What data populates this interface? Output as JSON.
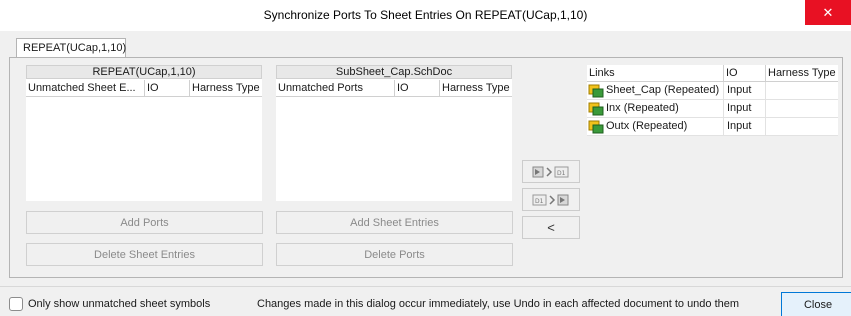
{
  "window": {
    "title": "Synchronize Ports To Sheet Entries On REPEAT(UCap,1,10)",
    "close_glyph": "✕"
  },
  "tab": {
    "label": "REPEAT(UCap,1,10)"
  },
  "left_grid": {
    "caption": "REPEAT(UCap,1,10)",
    "columns": [
      "Unmatched Sheet E...",
      "IO",
      "Harness Type"
    ],
    "buttons": {
      "add": "Add Ports",
      "delete": "Delete Sheet Entries"
    }
  },
  "middle_grid": {
    "caption": "SubSheet_Cap.SchDoc",
    "columns": [
      "Unmatched Ports",
      "IO",
      "Harness Type"
    ],
    "buttons": {
      "add": "Add Sheet Entries",
      "delete": "Delete Ports"
    }
  },
  "move_buttons": {
    "unlink_glyph": "<",
    "port_to_entry_icon": "port-to-sheet-entry-icon",
    "entry_to_port_icon": "sheet-entry-to-port-icon"
  },
  "links": {
    "columns": [
      "Links",
      "IO",
      "Harness Type"
    ],
    "rows": [
      {
        "name": "Sheet_Cap (Repeated)",
        "io": "Input",
        "harness": ""
      },
      {
        "name": "Inx (Repeated)",
        "io": "Input",
        "harness": ""
      },
      {
        "name": "Outx (Repeated)",
        "io": "Input",
        "harness": ""
      }
    ]
  },
  "footer": {
    "checkbox_label": "Only show unmatched sheet symbols",
    "checkbox_checked": false,
    "status": "Changes made in this dialog occur immediately, use Undo in each affected document to undo them",
    "close_label": "Close"
  },
  "colors": {
    "close_hover": "#e81123",
    "primary_border": "#0078d7",
    "icon_green": "#3a9a3a",
    "icon_yellow": "#f2c21b"
  }
}
